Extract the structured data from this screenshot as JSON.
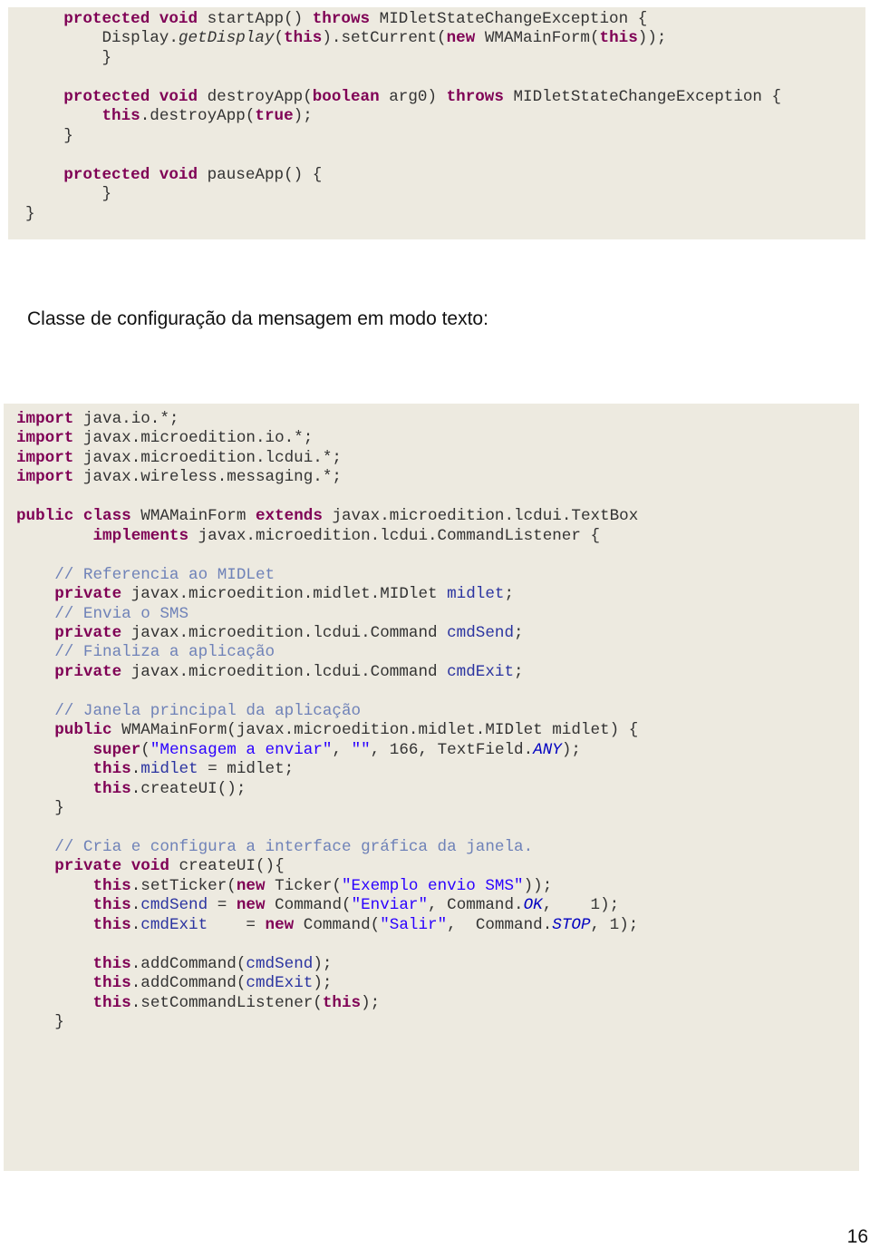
{
  "block1": {
    "lines": [
      [
        [
          "kw",
          "    protected void "
        ],
        [
          "plain",
          "startApp() "
        ],
        [
          "kw",
          "throws "
        ],
        [
          "plain",
          "MIDletStateChangeException {"
        ]
      ],
      [
        [
          "plain",
          "        Display."
        ],
        [
          "it",
          "getDisplay"
        ],
        [
          "plain",
          "("
        ],
        [
          "kw",
          "this"
        ],
        [
          "plain",
          ").setCurrent("
        ],
        [
          "kw",
          "new "
        ],
        [
          "plain",
          "WMAMainForm("
        ],
        [
          "kw",
          "this"
        ],
        [
          "plain",
          "));"
        ]
      ],
      [
        [
          "plain",
          "        }"
        ]
      ],
      [
        [
          "plain",
          ""
        ]
      ],
      [
        [
          "kw",
          "    protected void "
        ],
        [
          "plain",
          "destroyApp("
        ],
        [
          "kw",
          "boolean "
        ],
        [
          "plain",
          "arg0) "
        ],
        [
          "kw",
          "throws "
        ],
        [
          "plain",
          "MIDletStateChangeException {"
        ]
      ],
      [
        [
          "kw",
          "        this"
        ],
        [
          "plain",
          ".destroyApp("
        ],
        [
          "kw",
          "true"
        ],
        [
          "plain",
          ");"
        ]
      ],
      [
        [
          "plain",
          "    }"
        ]
      ],
      [
        [
          "plain",
          ""
        ]
      ],
      [
        [
          "kw",
          "    protected void "
        ],
        [
          "plain",
          "pauseApp() {"
        ]
      ],
      [
        [
          "plain",
          "        }"
        ]
      ],
      [
        [
          "plain",
          "}"
        ]
      ]
    ]
  },
  "heading": "Classe de configuração da mensagem em modo texto:",
  "block2": {
    "lines": [
      [
        [
          "kw",
          "import "
        ],
        [
          "plain",
          "java.io.*;"
        ]
      ],
      [
        [
          "kw",
          "import "
        ],
        [
          "plain",
          "javax.microedition.io.*;"
        ]
      ],
      [
        [
          "kw",
          "import "
        ],
        [
          "plain",
          "javax.microedition.lcdui.*;"
        ]
      ],
      [
        [
          "kw",
          "import "
        ],
        [
          "plain",
          "javax.wireless.messaging.*;"
        ]
      ],
      [
        [
          "plain",
          ""
        ]
      ],
      [
        [
          "kw",
          "public class "
        ],
        [
          "plain",
          "WMAMainForm "
        ],
        [
          "kw",
          "extends "
        ],
        [
          "plain",
          "javax.microedition.lcdui.TextBox"
        ]
      ],
      [
        [
          "kw",
          "        implements "
        ],
        [
          "plain",
          "javax.microedition.lcdui.CommandListener {"
        ]
      ],
      [
        [
          "plain",
          ""
        ]
      ],
      [
        [
          "cm",
          "    // Referencia ao MIDLet"
        ]
      ],
      [
        [
          "kw",
          "    private "
        ],
        [
          "plain",
          "javax.microedition.midlet.MIDlet "
        ],
        [
          "fld",
          "midlet"
        ],
        [
          "plain",
          ";"
        ]
      ],
      [
        [
          "cm",
          "    // Envia o SMS"
        ]
      ],
      [
        [
          "kw",
          "    private "
        ],
        [
          "plain",
          "javax.microedition.lcdui.Command "
        ],
        [
          "fld",
          "cmdSend"
        ],
        [
          "plain",
          ";"
        ]
      ],
      [
        [
          "cm",
          "    // Finaliza a aplicação"
        ]
      ],
      [
        [
          "kw",
          "    private "
        ],
        [
          "plain",
          "javax.microedition.lcdui.Command "
        ],
        [
          "fld",
          "cmdExit"
        ],
        [
          "plain",
          ";"
        ]
      ],
      [
        [
          "plain",
          ""
        ]
      ],
      [
        [
          "cm",
          "    // Janela principal da aplicação"
        ]
      ],
      [
        [
          "kw",
          "    public "
        ],
        [
          "plain",
          "WMAMainForm(javax.microedition.midlet.MIDlet midlet) {"
        ]
      ],
      [
        [
          "kw",
          "        super"
        ],
        [
          "plain",
          "("
        ],
        [
          "str",
          "\"Mensagem a enviar\""
        ],
        [
          "plain",
          ", "
        ],
        [
          "str",
          "\"\""
        ],
        [
          "plain",
          ", 166, TextField."
        ],
        [
          "st",
          "ANY"
        ],
        [
          "plain",
          ");"
        ]
      ],
      [
        [
          "kw",
          "        this"
        ],
        [
          "plain",
          "."
        ],
        [
          "fld",
          "midlet"
        ],
        [
          "plain",
          " = midlet;"
        ]
      ],
      [
        [
          "kw",
          "        this"
        ],
        [
          "plain",
          ".createUI();"
        ]
      ],
      [
        [
          "plain",
          "    }"
        ]
      ],
      [
        [
          "plain",
          ""
        ]
      ],
      [
        [
          "cm",
          "    // Cria e configura a interface gráfica da janela."
        ]
      ],
      [
        [
          "kw",
          "    private void "
        ],
        [
          "plain",
          "createUI(){"
        ]
      ],
      [
        [
          "kw",
          "        this"
        ],
        [
          "plain",
          ".setTicker("
        ],
        [
          "kw",
          "new "
        ],
        [
          "plain",
          "Ticker("
        ],
        [
          "str",
          "\"Exemplo envio SMS\""
        ],
        [
          "plain",
          "));"
        ]
      ],
      [
        [
          "kw",
          "        this"
        ],
        [
          "plain",
          "."
        ],
        [
          "fld",
          "cmdSend"
        ],
        [
          "plain",
          " = "
        ],
        [
          "kw",
          "new "
        ],
        [
          "plain",
          "Command("
        ],
        [
          "str",
          "\"Enviar\""
        ],
        [
          "plain",
          ", Command."
        ],
        [
          "st",
          "OK"
        ],
        [
          "plain",
          ",    1);"
        ]
      ],
      [
        [
          "kw",
          "        this"
        ],
        [
          "plain",
          "."
        ],
        [
          "fld",
          "cmdExit"
        ],
        [
          "plain",
          "    = "
        ],
        [
          "kw",
          "new "
        ],
        [
          "plain",
          "Command("
        ],
        [
          "str",
          "\"Salir\""
        ],
        [
          "plain",
          ",  Command."
        ],
        [
          "st",
          "STOP"
        ],
        [
          "plain",
          ", 1);"
        ]
      ],
      [
        [
          "plain",
          ""
        ]
      ],
      [
        [
          "kw",
          "        this"
        ],
        [
          "plain",
          ".addCommand("
        ],
        [
          "fld",
          "cmdSend"
        ],
        [
          "plain",
          ");"
        ]
      ],
      [
        [
          "kw",
          "        this"
        ],
        [
          "plain",
          ".addCommand("
        ],
        [
          "fld",
          "cmdExit"
        ],
        [
          "plain",
          ");"
        ]
      ],
      [
        [
          "kw",
          "        this"
        ],
        [
          "plain",
          ".setCommandListener("
        ],
        [
          "kw",
          "this"
        ],
        [
          "plain",
          ");"
        ]
      ],
      [
        [
          "plain",
          "    }"
        ]
      ]
    ]
  },
  "page_number": "16"
}
